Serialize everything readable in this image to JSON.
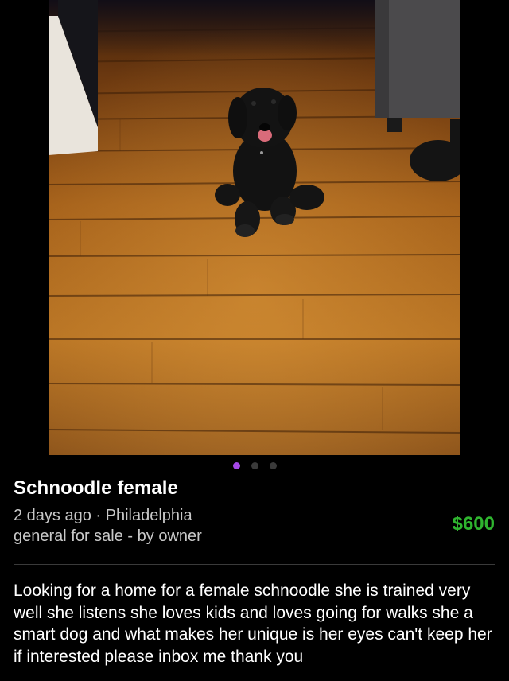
{
  "listing": {
    "title": "Schnoodle female",
    "posted": "2 days ago · Philadelphia",
    "category": "general for sale - by owner",
    "price": "$600",
    "description": "Looking for a home for a female schnoodle she is trained very well she listens she loves kids and loves going for walks she a smart dog and what makes her unique is her eyes can't keep her if interested please inbox me thank you"
  },
  "gallery": {
    "image_count": 3,
    "active_index": 0
  },
  "colors": {
    "background": "#000000",
    "price": "#2fb52f",
    "active_dot": "#a447e6",
    "inactive_dot": "#3a3a3a"
  }
}
